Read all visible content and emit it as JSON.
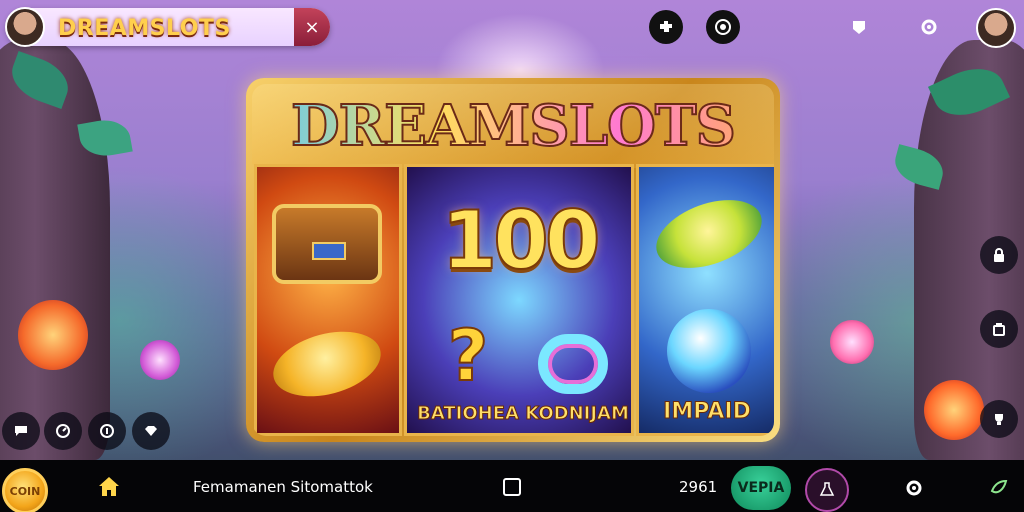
{
  "header": {
    "brand_title": "DREAMSLOTS",
    "close_symbol": "×",
    "icons": [
      "puzzle-icon",
      "target-icon",
      "shield-icon",
      "gear-icon"
    ]
  },
  "game": {
    "logo_text": "DREAMSLOTS",
    "big_number": "100",
    "question_symbol": "?",
    "labels": {
      "bottom_left": "BATIOHEA KODNIJAM",
      "bottom_right": "IMPAID"
    }
  },
  "side": {
    "right_icons": [
      "lock-icon",
      "bag-icon",
      "trophy-icon"
    ],
    "left_icons": [
      "chat-icon",
      "compass-icon",
      "info-icon",
      "diamond-icon"
    ]
  },
  "footer": {
    "coin_label": "COIN",
    "text": "Femamanen Sitomattok",
    "count": "2961",
    "button_label": "VEPIA"
  },
  "colors": {
    "accent_gold": "#f2cb63",
    "accent_green": "#0f8a5b",
    "brand_red": "#8a1e39"
  }
}
